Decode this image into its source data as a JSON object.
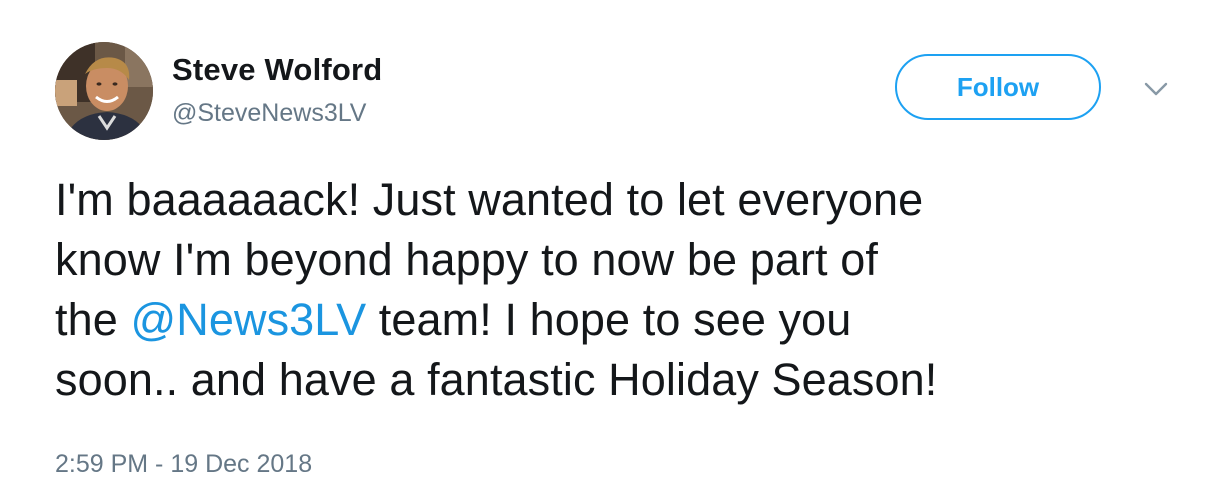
{
  "author": {
    "display_name": "Steve Wolford",
    "handle": "@SteveNews3LV"
  },
  "actions": {
    "follow_label": "Follow",
    "caret_icon": "chevron-down-icon"
  },
  "tweet": {
    "line1": "I'm baaaaaack! Just wanted to let everyone",
    "line2": "know I'm beyond happy to now be part of",
    "line3_before": "the ",
    "line3_mention": "@News3LV",
    "line3_after": " team! I hope to see you",
    "line4": "soon.. and have a fantastic Holiday Season!"
  },
  "meta": {
    "timestamp": "2:59 PM - 19 Dec 2018"
  },
  "colors": {
    "accent": "#1da1f2",
    "mention": "#1b95e0",
    "text": "#14171a",
    "secondary": "#657786"
  }
}
